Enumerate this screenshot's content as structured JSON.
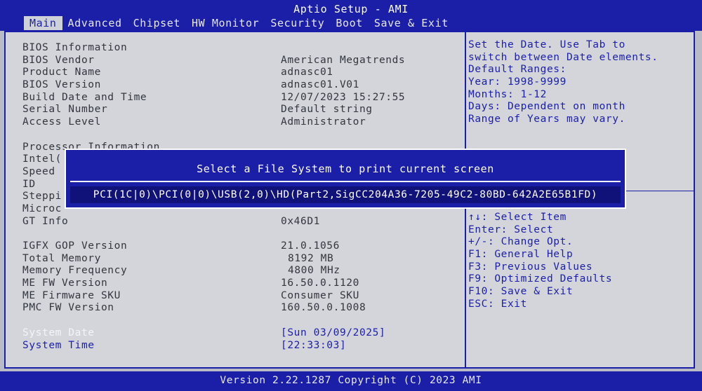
{
  "app": {
    "title": "Aptio Setup - AMI"
  },
  "tabs": [
    "Main",
    "Advanced",
    "Chipset",
    "HW Monitor",
    "Security",
    "Boot",
    "Save & Exit"
  ],
  "info": {
    "bios_information": "BIOS Information",
    "bios_vendor_label": "BIOS Vendor",
    "bios_vendor_value": "American Megatrends",
    "product_name_label": "Product Name",
    "product_name_value": "adnasc01",
    "bios_version_label": "BIOS Version",
    "bios_version_value": "adnasc01.V01",
    "build_date_label": "Build Date and Time",
    "build_date_value": "12/07/2023 15:27:55",
    "serial_label": "Serial Number",
    "serial_value": "Default string",
    "access_label": "Access Level",
    "access_value": "Administrator",
    "processor_information": "Processor Information",
    "intel_label": "Intel(",
    "speed_label": "Speed",
    "id_label": "ID",
    "stepping_label": "Steppi",
    "microcode_label": "Microc",
    "gt_info_label": "GT Info",
    "gt_info_value": "0x46D1",
    "igfx_label": "IGFX GOP Version",
    "igfx_value": "21.0.1056",
    "total_memory_label": "Total Memory",
    "total_memory_value": "8192 MB",
    "memory_freq_label": "Memory Frequency",
    "memory_freq_value": "4800 MHz",
    "me_fw_label": "ME FW Version",
    "me_fw_value": "16.50.0.1120",
    "me_sku_label": "ME Firmware SKU",
    "me_sku_value": "Consumer SKU",
    "pmc_label": "PMC FW Version",
    "pmc_value": "160.50.0.1008",
    "system_date_label": "System Date",
    "system_date_value": "[Sun 03/09/2025]",
    "system_time_label": "System Time",
    "system_time_value": "[22:33:03]"
  },
  "help": [
    "Set the Date. Use Tab to",
    "switch between Date elements.",
    "Default Ranges:",
    "Year: 1998-9999",
    "Months: 1-12",
    "Days: Dependent on month",
    "Range of Years may vary."
  ],
  "keys": [
    "↑↓: Select Item",
    "Enter: Select",
    "+/-: Change Opt.",
    "F1: General Help",
    "F3: Previous Values",
    "F9: Optimized Defaults",
    "F10: Save & Exit",
    "ESC: Exit"
  ],
  "dialog": {
    "title": "Select a File System to print current screen",
    "option": "PCI(1C|0)\\PCI(0|0)\\USB(2,0)\\HD(Part2,SigCC204A36-7205-49C2-80BD-642A2E65B1FD)"
  },
  "footer": {
    "text": "Version 2.22.1287 Copyright (C) 2023 AMI"
  }
}
